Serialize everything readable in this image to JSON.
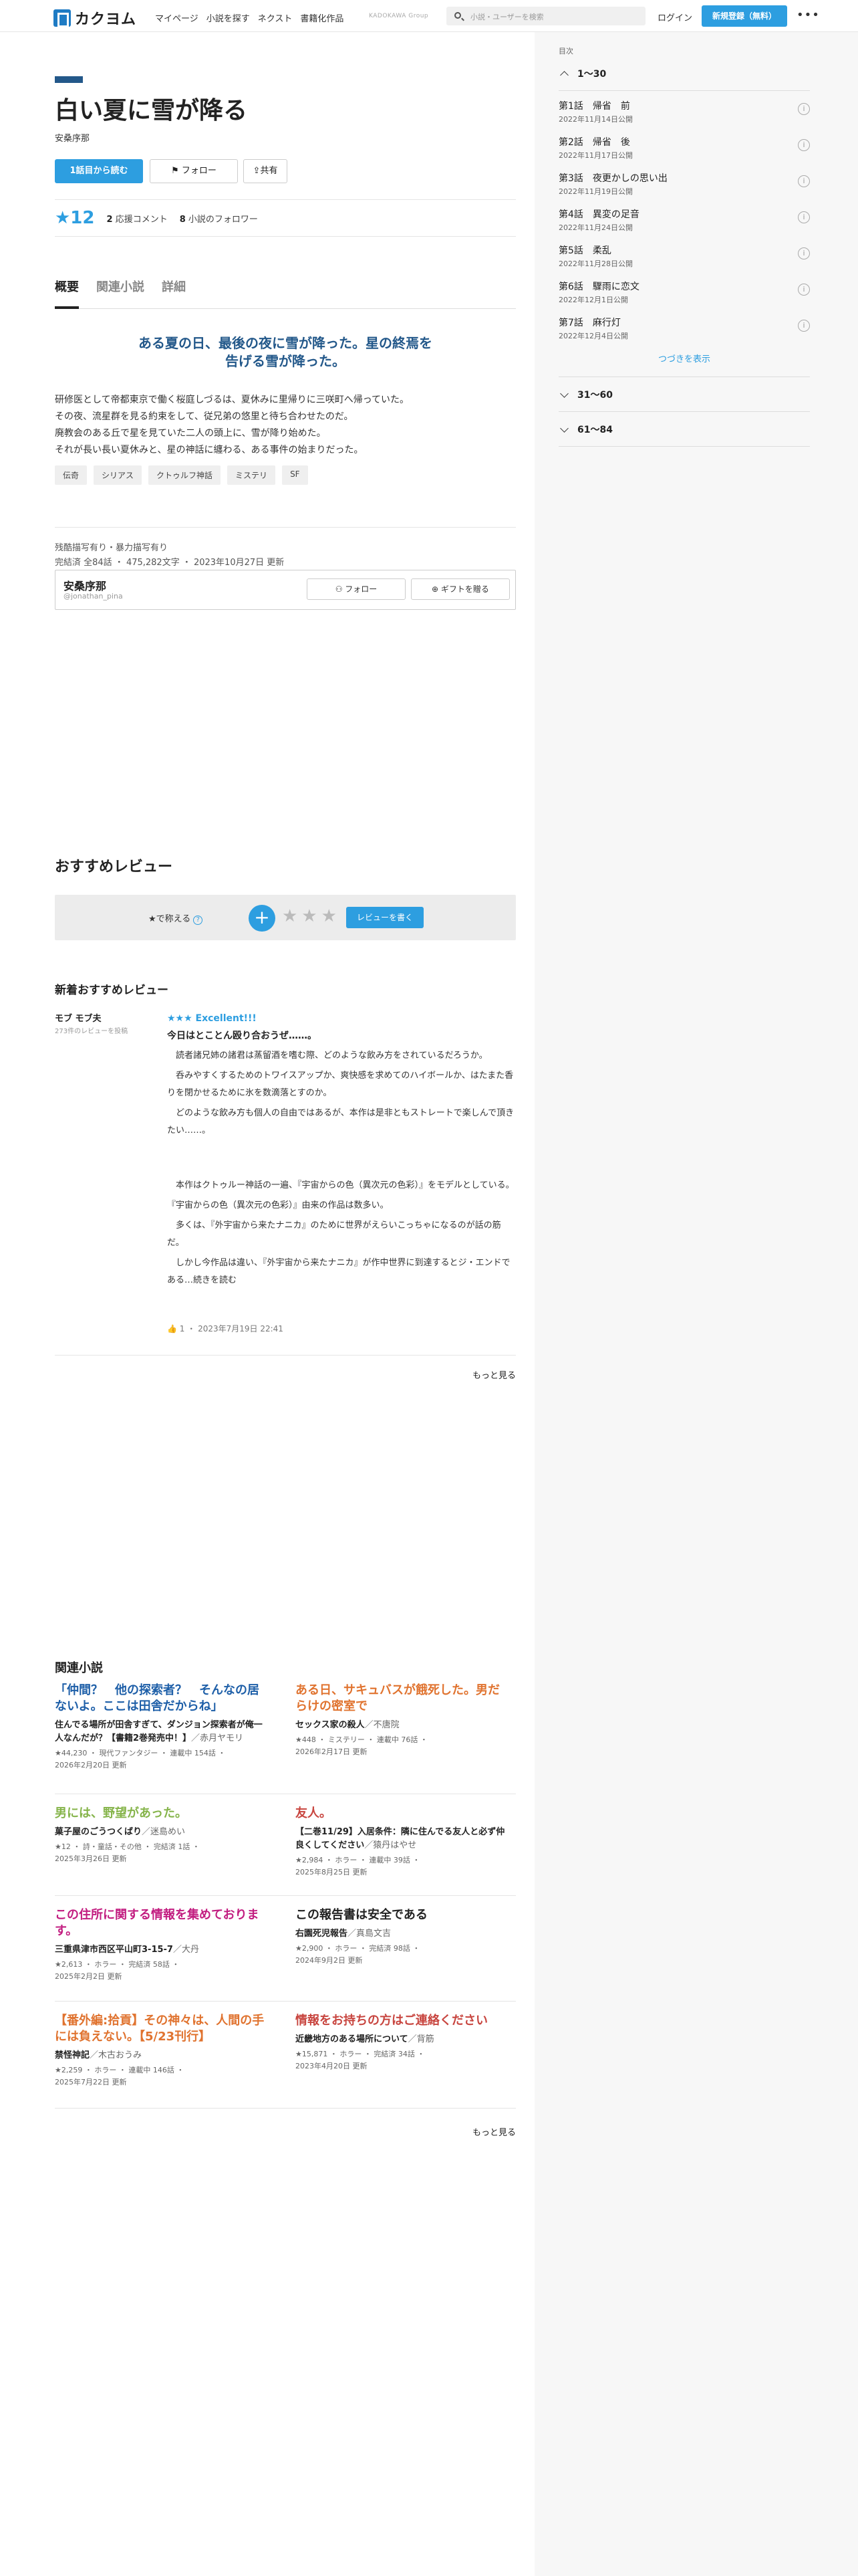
{
  "header": {
    "logo": "カクヨム",
    "nav": [
      "マイページ",
      "小説を探す",
      "ネクスト",
      "書籍化作品"
    ],
    "group": "KADOKAWA Group",
    "search_placeholder": "小説・ユーザーを検索",
    "login": "ログイン",
    "signup": "新規登録（無料）",
    "more": "•••"
  },
  "work": {
    "title": "白い夏に雪が降る",
    "author": "安桑序那",
    "btn_read": "1話目から読む",
    "btn_follow": "フォロー",
    "btn_share": "共有",
    "stars": "★12",
    "comments_n": "2",
    "comments_l": "応援コメント",
    "followers_n": "8",
    "followers_l": "小説のフォロワー"
  },
  "tabs": [
    "概要",
    "関連小説",
    "詳細"
  ],
  "catch": "ある夏の日、最後の夜に雪が降った。星の終焉を告げる雪が降った。",
  "intro": [
    "研修医として帝都東京で働く桜庭しづるは、夏休みに里帰りに三咲町へ帰っていた。",
    "その夜、流星群を見る約束をして、従兄弟の悠里と待ち合わせたのだ。",
    "廃教会のある丘で星を見ていた二人の頭上に、雪が降り始めた。",
    "それが長い長い夏休みと、星の神話に纏わる、ある事件の始まりだった。"
  ],
  "tags": [
    "伝奇",
    "シリアス",
    "クトゥルフ神話",
    "ミステリ",
    "SF"
  ],
  "meta": {
    "warn": "残酷描写有り・暴力描写有り",
    "info": "完結済 全84話 ・ 475,282文字 ・ 2023年10月27日 更新"
  },
  "author_card": {
    "name": "安桑序那",
    "handle": "@jonathan_pina",
    "follow": "フォロー",
    "gift": "ギフトを贈る"
  },
  "reviews": {
    "heading": "おすすめレビュー",
    "prompt": "★で称える",
    "write": "レビューを書く",
    "sub_heading": "新着おすすめレビュー",
    "reviewer": "モブ モブ夫",
    "reviewer_count": "273件のレビューを投稿",
    "excellent": "★★★ Excellent!!!",
    "title": "今日はとことん殴り合おうぜ……。",
    "body": [
      "　読者諸兄姉の諸君は蒸留酒を嗜む際、どのような飲み方をされているだろうか。",
      "　呑みやすくするためのトワイスアップか、爽快感を求めてのハイボールか、はたまた香りを閉かせるために氷を数滴落とすのか。",
      "　どのような飲み方も個人の自由ではあるが、本作は是非ともストレートで楽しんで頂きたい……。",
      "　本作はクトゥルー神話の一遍、『宇宙からの色（異次元の色彩）』をモデルとしている。",
      "『宇宙からの色（異次元の色彩）』由来の作品は数多い。",
      "　多くは、『外宇宙から来たナニカ』のために世界がえらいこっちゃになるのが話の筋だ。",
      "　しかし今作品は違い、『外宇宙から来たナニカ』が作中世界に到達するとジ・エンドである…続きを読む"
    ],
    "likes": "1",
    "date": "2023年7月19日 22:41",
    "more": "もっと見る"
  },
  "related": {
    "heading": "関連小説",
    "more": "もっと見る",
    "items": [
      {
        "title": "「仲間？　他の探索者？　そんなの居ないよ。ここは田舎だからね」",
        "color": "#1e5fa8",
        "sub": "住んでる場所が田舎すぎて、ダンジョン探索者が俺一人なんだが？【書籍2巻発売中！】",
        "author": "／赤月ヤモリ",
        "m1": "★44,230 ・ 現代ファンタジー ・ 連載中 154話 ・",
        "m2": "2026年2月20日 更新"
      },
      {
        "title": "ある日、サキュバスが餓死した。男だらけの密室で",
        "color": "#e0732f",
        "sub": "セックス家の殺人",
        "author": "／不唐院",
        "m1": "★448 ・ ミステリー ・ 連載中 76話 ・",
        "m2": "2026年2月17日 更新"
      },
      {
        "title": "男には、野望があった。",
        "color": "#85b44a",
        "sub": "菓子屋のごうつくばり",
        "author": "／迷島めい",
        "m1": "★12 ・ 詩・童話・その他 ・ 完結済 1話 ・",
        "m2": "2025年3月26日 更新"
      },
      {
        "title": "友人。",
        "color": "#c8453f",
        "sub": "【二巻11/29】入居条件：隣に住んでる友人と必ず仲良くしてください",
        "author": "／猿丹はやせ",
        "m1": "★2,984 ・ ホラー ・ 連載中 39話 ・",
        "m2": "2025年8月25日 更新"
      },
      {
        "title": "この住所に関する情報を集めております。",
        "color": "#c21d80",
        "sub": "三重県津市西区平山町3-15-7",
        "author": "／大丹",
        "m1": "★2,613 ・ ホラー ・ 完結済 58話 ・",
        "m2": "2025年2月2日 更新"
      },
      {
        "title": "この報告書は安全である",
        "color": "#222222",
        "sub": "右園死児報告",
        "author": "／真島文吉",
        "m1": "★2,900 ・ ホラー ・ 完結済 98話 ・",
        "m2": "2024年9月2日 更新"
      },
      {
        "title": "【番外編:拾貢】その神々は、人間の手には負えない。【5/23刊行】",
        "color": "#e0732f",
        "sub": "禁怪神記",
        "author": "／木古おうみ",
        "m1": "★2,259 ・ ホラー ・ 連載中 146話 ・",
        "m2": "2025年7月22日 更新"
      },
      {
        "title": "情報をお持ちの方はご連絡ください",
        "color": "#c8453f",
        "sub": "近畿地方のある場所について",
        "author": "／背筋",
        "m1": "★15,871 ・ ホラー ・ 完結済 34話 ・",
        "m2": "2023年4月20日 更新"
      }
    ]
  },
  "toc": {
    "label": "目次",
    "ch1": "1〜30",
    "ch2": "31〜60",
    "ch3": "61〜84",
    "continue": "つづきを表示",
    "info_icon": "i",
    "episodes": [
      {
        "t": "第1話　帰省　前",
        "d": "2022年11月14日公開"
      },
      {
        "t": "第2話　帰省　後",
        "d": "2022年11月17日公開"
      },
      {
        "t": "第3話　夜更かしの思い出",
        "d": "2022年11月19日公開"
      },
      {
        "t": "第4話　異変の足音",
        "d": "2022年11月24日公開"
      },
      {
        "t": "第5話　柔乱",
        "d": "2022年11月28日公開"
      },
      {
        "t": "第6話　驟雨に恋文",
        "d": "2022年12月1日公開"
      },
      {
        "t": "第7話　麻行灯",
        "d": "2022年12月4日公開"
      }
    ]
  }
}
